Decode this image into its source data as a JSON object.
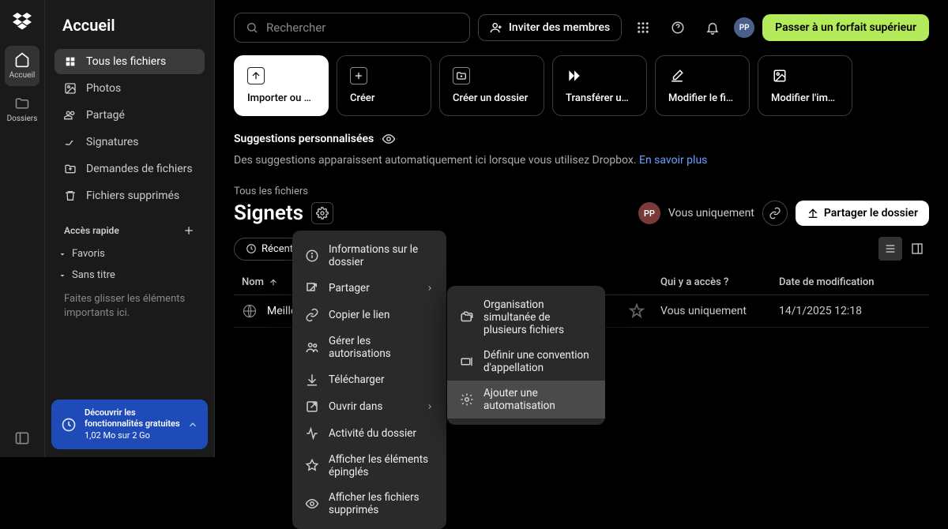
{
  "rail": {
    "home": "Accueil",
    "folders": "Dossiers"
  },
  "sidebar": {
    "title": "Accueil",
    "items": [
      "Tous les fichiers",
      "Photos",
      "Partagé",
      "Signatures",
      "Demandes de fichiers",
      "Fichiers supprimés"
    ],
    "quick_access": "Accès rapide",
    "favorites": "Favoris",
    "untitled": "Sans titre",
    "drag_hint": "Faites glisser les éléments importants ici."
  },
  "promo": {
    "title": "Découvrir les fonctionnalités gratuites",
    "storage": "1,02 Mo sur 2 Go"
  },
  "topbar": {
    "search_placeholder": "Rechercher",
    "invite": "Inviter des membres",
    "avatar": "PP",
    "upgrade": "Passer à un forfait supérieur"
  },
  "cards": {
    "upload": "Importer ou dé…",
    "create": "Créer",
    "create_folder": "Créer un dossier",
    "transfer": "Transférer une …",
    "edit_file": "Modifier le fichi…",
    "edit_image": "Modifier l'image"
  },
  "suggestions": {
    "title": "Suggestions personnalisées",
    "text": "Des suggestions apparaissent automatiquement ici lorsque vous utilisez Dropbox. ",
    "link": "En savoir plus"
  },
  "folder": {
    "breadcrumb": "Tous les fichiers",
    "name": "Signets",
    "only_you": "Vous uniquement",
    "share": "Partager le dossier",
    "pp": "PP"
  },
  "filters": {
    "recents": "Récents"
  },
  "table": {
    "col_name": "Nom",
    "col_access": "Qui y a accès ?",
    "col_date": "Date de modification",
    "row_name": "Meilleur",
    "row_access": "Vous uniquement",
    "row_date": "14/1/2025 12:18"
  },
  "menu1": {
    "info": "Informations sur le dossier",
    "share": "Partager",
    "copy_link": "Copier le lien",
    "manage_perms": "Gérer les autorisations",
    "download": "Télécharger",
    "open_in": "Ouvrir dans",
    "activity": "Activité du dossier",
    "pinned": "Afficher les éléments épinglés",
    "deleted": "Afficher les fichiers supprimés"
  },
  "menu2": {
    "organize": "Organisation simultanée de plusieurs fichiers",
    "naming": "Définir une convention d'appellation",
    "automation": "Ajouter une automatisation"
  }
}
